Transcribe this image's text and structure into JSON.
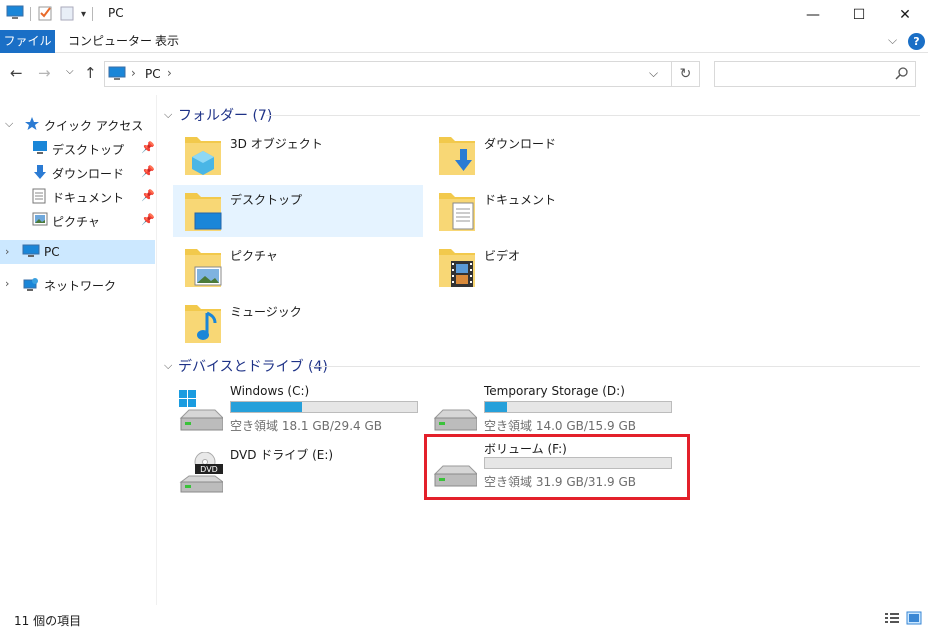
{
  "window": {
    "title": "PC",
    "minimize_glyph": "—",
    "maximize_glyph": "☐",
    "close_glyph": "✕"
  },
  "ribbon": {
    "tabs": [
      "ファイル",
      "コンピューター",
      "表示"
    ],
    "help_glyph": "?"
  },
  "address": {
    "crumb": "PC"
  },
  "nav": {
    "quick_access": "クイック アクセス",
    "quick_items": [
      "デスクトップ",
      "ダウンロード",
      "ドキュメント",
      "ピクチャ"
    ],
    "pc": "PC",
    "network": "ネットワーク"
  },
  "folders": {
    "header": "フォルダー (7)",
    "items": [
      "3D オブジェクト",
      "ダウンロード",
      "デスクトップ",
      "ドキュメント",
      "ピクチャ",
      "ビデオ",
      "ミュージック"
    ]
  },
  "drives": {
    "header": "デバイスとドライブ (4)",
    "items": [
      {
        "name": "Windows (C:)",
        "free": "空き領域 18.1 GB/29.4 GB",
        "used_fraction": 0.384
      },
      {
        "name": "Temporary Storage (D:)",
        "free": "空き領域 14.0 GB/15.9 GB",
        "used_fraction": 0.12
      },
      {
        "name": "DVD ドライブ (E:)"
      },
      {
        "name": "ボリューム (F:)",
        "free": "空き領域 31.9 GB/31.9 GB",
        "used_fraction": 0.0
      }
    ],
    "dvd_badge": "DVD"
  },
  "status": {
    "count": "11 個の項目"
  },
  "colors": {
    "accent": "#1a6fc6",
    "selection": "#cce8ff",
    "highlight_box": "#e3202a",
    "bar_fill": "#26a0da"
  }
}
